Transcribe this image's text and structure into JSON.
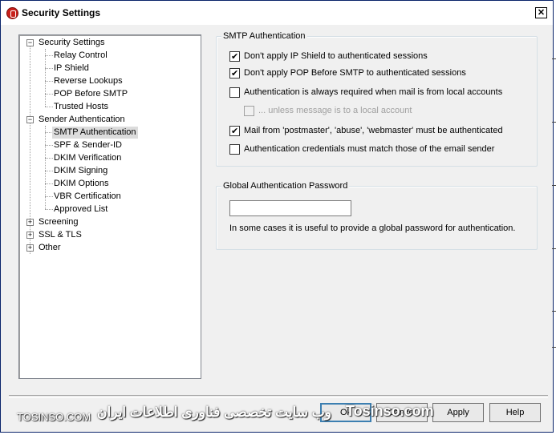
{
  "window": {
    "title": "Security Settings",
    "close_glyph": "✕"
  },
  "tree": {
    "items": [
      {
        "label": "Security Settings",
        "expander": "−"
      },
      {
        "label": "Relay Control"
      },
      {
        "label": "IP Shield"
      },
      {
        "label": "Reverse Lookups"
      },
      {
        "label": "POP Before SMTP"
      },
      {
        "label": "Trusted Hosts"
      },
      {
        "label": "Sender Authentication",
        "expander": "−"
      },
      {
        "label": "SMTP Authentication",
        "selected": true
      },
      {
        "label": "SPF & Sender-ID"
      },
      {
        "label": "DKIM Verification"
      },
      {
        "label": "DKIM Signing"
      },
      {
        "label": "DKIM Options"
      },
      {
        "label": "VBR Certification"
      },
      {
        "label": "Approved List"
      },
      {
        "label": "Screening",
        "expander": "+"
      },
      {
        "label": "SSL & TLS",
        "expander": "+"
      },
      {
        "label": "Other",
        "expander": "+"
      }
    ]
  },
  "smtp_auth": {
    "title": "SMTP Authentication",
    "options": [
      {
        "label": "Don't apply IP Shield to authenticated sessions",
        "checked": true,
        "enabled": true
      },
      {
        "label": "Don't apply POP Before SMTP to authenticated sessions",
        "checked": true,
        "enabled": true
      },
      {
        "label": "Authentication is always required when mail is from local accounts",
        "checked": false,
        "enabled": true
      },
      {
        "label": "... unless message is to a local account",
        "checked": false,
        "enabled": false
      },
      {
        "label": "Mail from 'postmaster', 'abuse', 'webmaster' must be authenticated",
        "checked": true,
        "enabled": true
      },
      {
        "label": "Authentication credentials must match those of the email sender",
        "checked": false,
        "enabled": true
      }
    ]
  },
  "global_password": {
    "title": "Global Authentication Password",
    "value": "",
    "description": "In some cases it is useful to provide a global password for authentication."
  },
  "buttons": {
    "ok": "Ok",
    "cancel": "Cancel",
    "apply": "Apply",
    "help": "Help"
  },
  "watermark": {
    "left_text": "TOSINSO.COM",
    "right_text": "Tosinso.com",
    "persian_text": "وب سایت تخصصی فناوری اطلاعات ایران"
  }
}
